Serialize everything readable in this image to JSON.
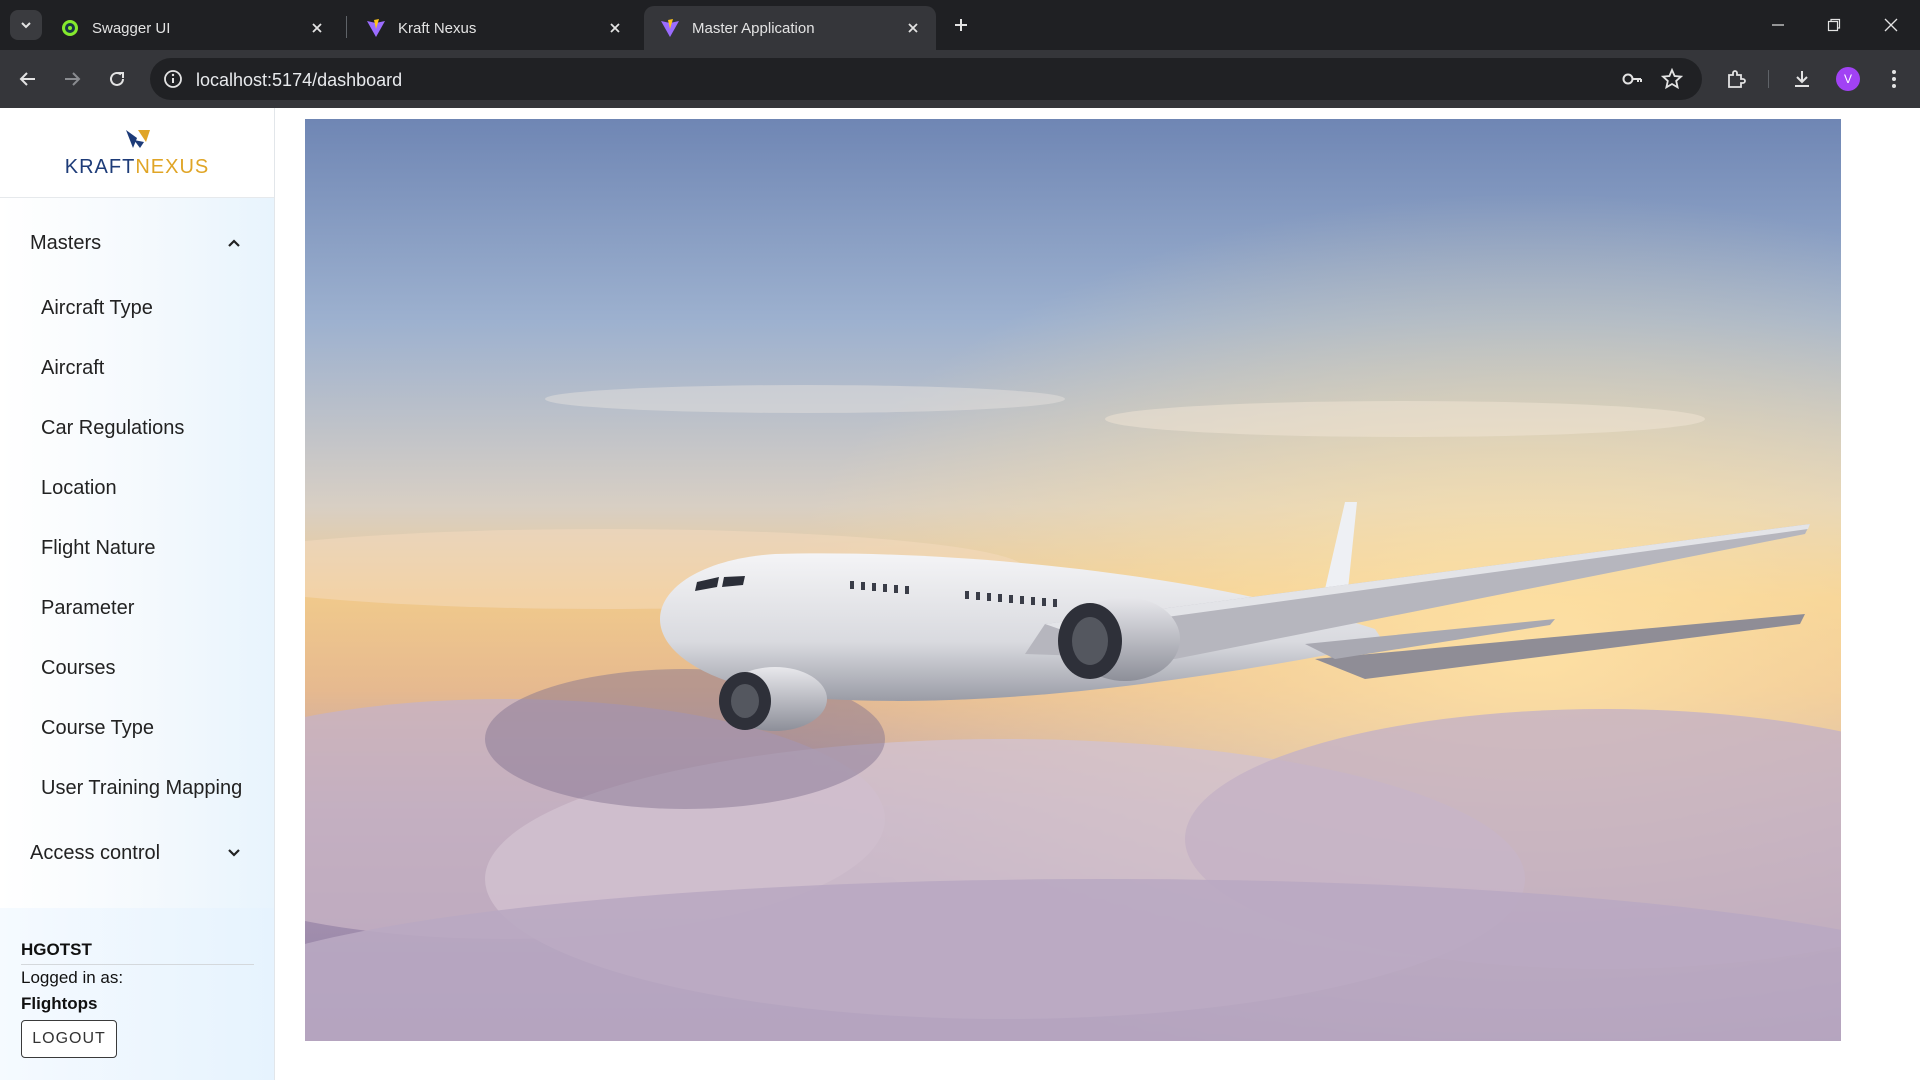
{
  "browser": {
    "tabs": [
      {
        "title": "Swagger UI",
        "favicon": "swagger-icon",
        "active": false
      },
      {
        "title": "Kraft Nexus",
        "favicon": "vite-icon",
        "active": false
      },
      {
        "title": "Master Application",
        "favicon": "vite-icon",
        "active": true
      }
    ],
    "url": "localhost:5174/dashboard",
    "profile_initial": "V",
    "colors": {
      "tabstrip": "#1f2023",
      "toolbar": "#35363a",
      "omnibox": "#202124",
      "avatar": "#a142f4"
    }
  },
  "app": {
    "logo": {
      "part1": "KRAFT",
      "part2": "NEXUS",
      "color1": "#1d3b78",
      "color2": "#e0a526"
    },
    "sidebar": {
      "masters_group": {
        "label": "Masters",
        "expanded": true
      },
      "items": [
        {
          "label": "Aircraft Type"
        },
        {
          "label": "Aircraft"
        },
        {
          "label": "Car Regulations"
        },
        {
          "label": "Location"
        },
        {
          "label": "Flight Nature"
        },
        {
          "label": "Parameter"
        },
        {
          "label": "Courses"
        },
        {
          "label": "Course Type"
        },
        {
          "label": "User Training Mapping"
        }
      ],
      "access_group": {
        "label": "Access control",
        "expanded": false
      }
    },
    "user": {
      "org": "HGOTST",
      "logged_in_label": "Logged in as:",
      "role": "Flightops",
      "logout_label": "LOGOUT"
    }
  }
}
